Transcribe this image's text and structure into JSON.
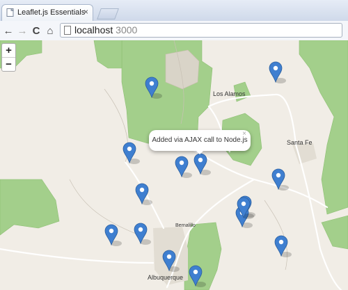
{
  "browser": {
    "tab": {
      "title": "Leaflet.js Essentials",
      "close": "×"
    },
    "toolbar": {
      "back": "←",
      "forward": "→",
      "reload": "C",
      "home": "⌂"
    },
    "address": {
      "host": "localhost",
      "port": "3000"
    }
  },
  "map": {
    "zoom": {
      "in": "+",
      "out": "−"
    },
    "popup": {
      "text": "Added via AJAX call to Node.js",
      "close": "×"
    },
    "labels": {
      "los_alamos": "Los Alamos",
      "santa_fe": "Santa Fe",
      "bernalillo": "Bernalillo",
      "albuquerque": "Albuquerque"
    },
    "colors": {
      "land": "#f1ede6",
      "park": "#9fce87",
      "road": "#ffffff",
      "marker": "#3f7fd0"
    },
    "marker_count": 15
  }
}
